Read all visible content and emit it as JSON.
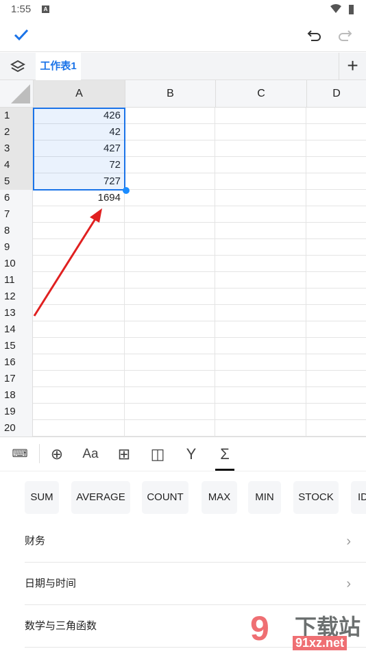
{
  "status": {
    "time": "1:55",
    "notification": "A"
  },
  "topbar": {
    "confirm_icon": "check-icon",
    "undo_icon": "undo-icon",
    "redo_icon": "redo-icon"
  },
  "tabs": {
    "sheet": "工作表1",
    "add_icon": "plus-icon"
  },
  "columns": [
    "A",
    "B",
    "C",
    "D"
  ],
  "rows": [
    {
      "n": "1",
      "a": "426"
    },
    {
      "n": "2",
      "a": "42"
    },
    {
      "n": "3",
      "a": "427"
    },
    {
      "n": "4",
      "a": "72"
    },
    {
      "n": "5",
      "a": "727"
    },
    {
      "n": "6",
      "a": "1694"
    },
    {
      "n": "7",
      "a": ""
    },
    {
      "n": "8",
      "a": ""
    },
    {
      "n": "9",
      "a": ""
    },
    {
      "n": "10",
      "a": ""
    },
    {
      "n": "11",
      "a": ""
    },
    {
      "n": "12",
      "a": ""
    },
    {
      "n": "13",
      "a": ""
    },
    {
      "n": "14",
      "a": ""
    },
    {
      "n": "15",
      "a": ""
    },
    {
      "n": "16",
      "a": ""
    },
    {
      "n": "17",
      "a": ""
    },
    {
      "n": "18",
      "a": ""
    },
    {
      "n": "19",
      "a": ""
    },
    {
      "n": "20",
      "a": ""
    }
  ],
  "selection": {
    "range": "A1:A5",
    "color": "#1a73e8"
  },
  "annotation_color": "#e02020",
  "toolbar": [
    "keyboard-icon",
    "insert-icon",
    "font-icon",
    "border-icon",
    "freeze-icon",
    "filter-icon",
    "sum-icon"
  ],
  "functions": [
    "SUM",
    "AVERAGE",
    "COUNT",
    "MAX",
    "MIN",
    "STOCK",
    "ID"
  ],
  "categories": [
    "财务",
    "日期与时间",
    "数学与三角函数"
  ],
  "watermark": "91下载站 91xz.net"
}
